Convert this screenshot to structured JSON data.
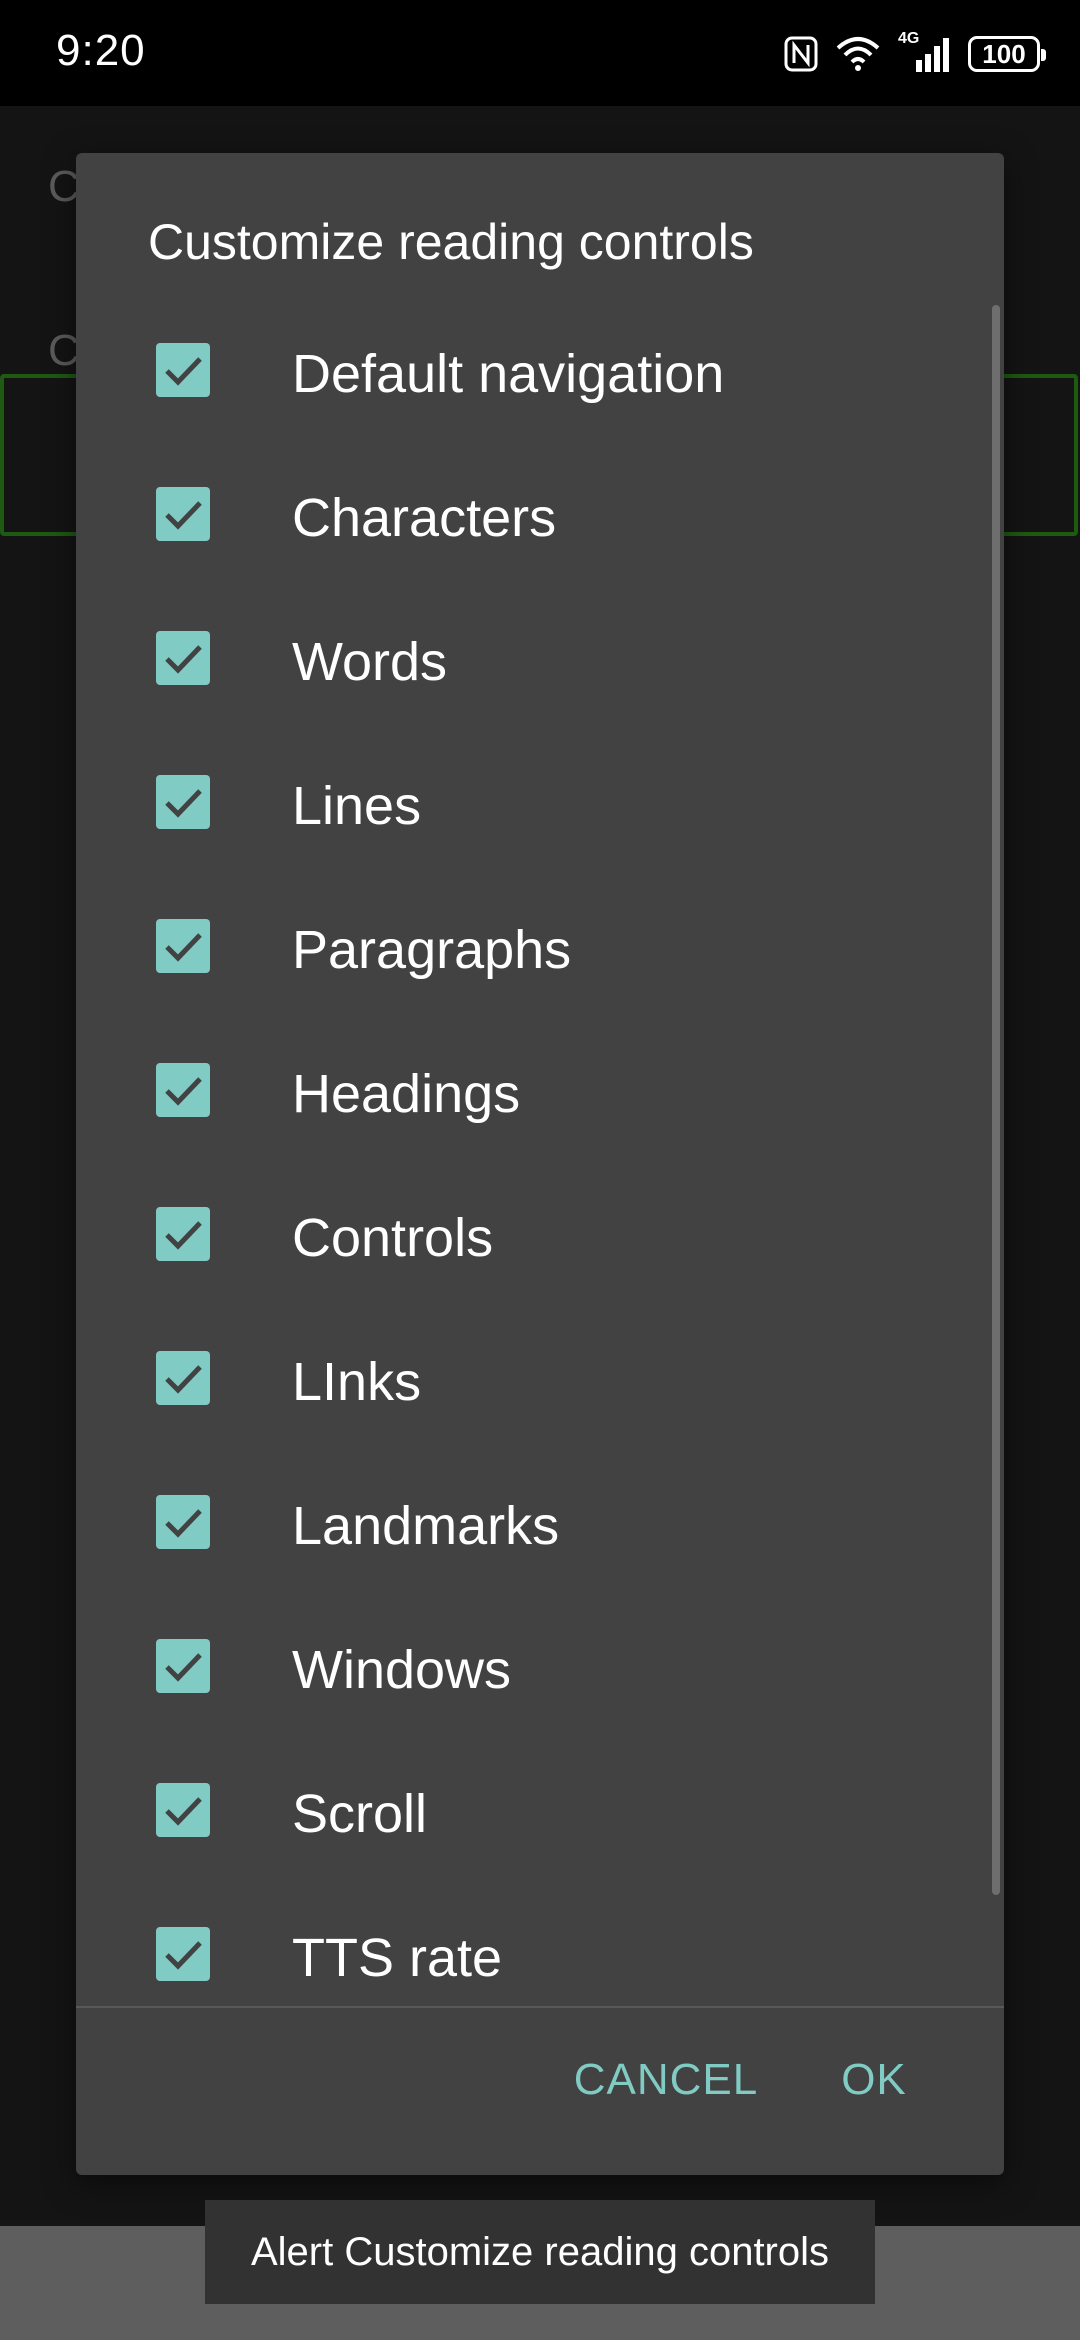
{
  "status_bar": {
    "time": "9:20",
    "network": "4G",
    "battery": "100",
    "icons": [
      "nfc-icon",
      "wifi-icon",
      "signal-icon",
      "battery-icon"
    ]
  },
  "background": {
    "row_letters": [
      "C",
      "C"
    ]
  },
  "dialog": {
    "title": "Customize reading controls",
    "items": [
      {
        "label": "Default navigation",
        "checked": true
      },
      {
        "label": "Characters",
        "checked": true
      },
      {
        "label": "Words",
        "checked": true
      },
      {
        "label": "Lines",
        "checked": true
      },
      {
        "label": "Paragraphs",
        "checked": true
      },
      {
        "label": "Headings",
        "checked": true
      },
      {
        "label": "Controls",
        "checked": true
      },
      {
        "label": "LInks",
        "checked": true
      },
      {
        "label": "Landmarks",
        "checked": true
      },
      {
        "label": "Windows",
        "checked": true
      },
      {
        "label": "Scroll",
        "checked": true
      },
      {
        "label": "TTS rate",
        "checked": true
      }
    ],
    "cancel_label": "CANCEL",
    "ok_label": "OK"
  },
  "toast": {
    "text": "Alert Customize reading controls"
  },
  "colors": {
    "accent": "#80cbc4",
    "dialog_bg": "#424242",
    "screen_bg": "#141414"
  }
}
